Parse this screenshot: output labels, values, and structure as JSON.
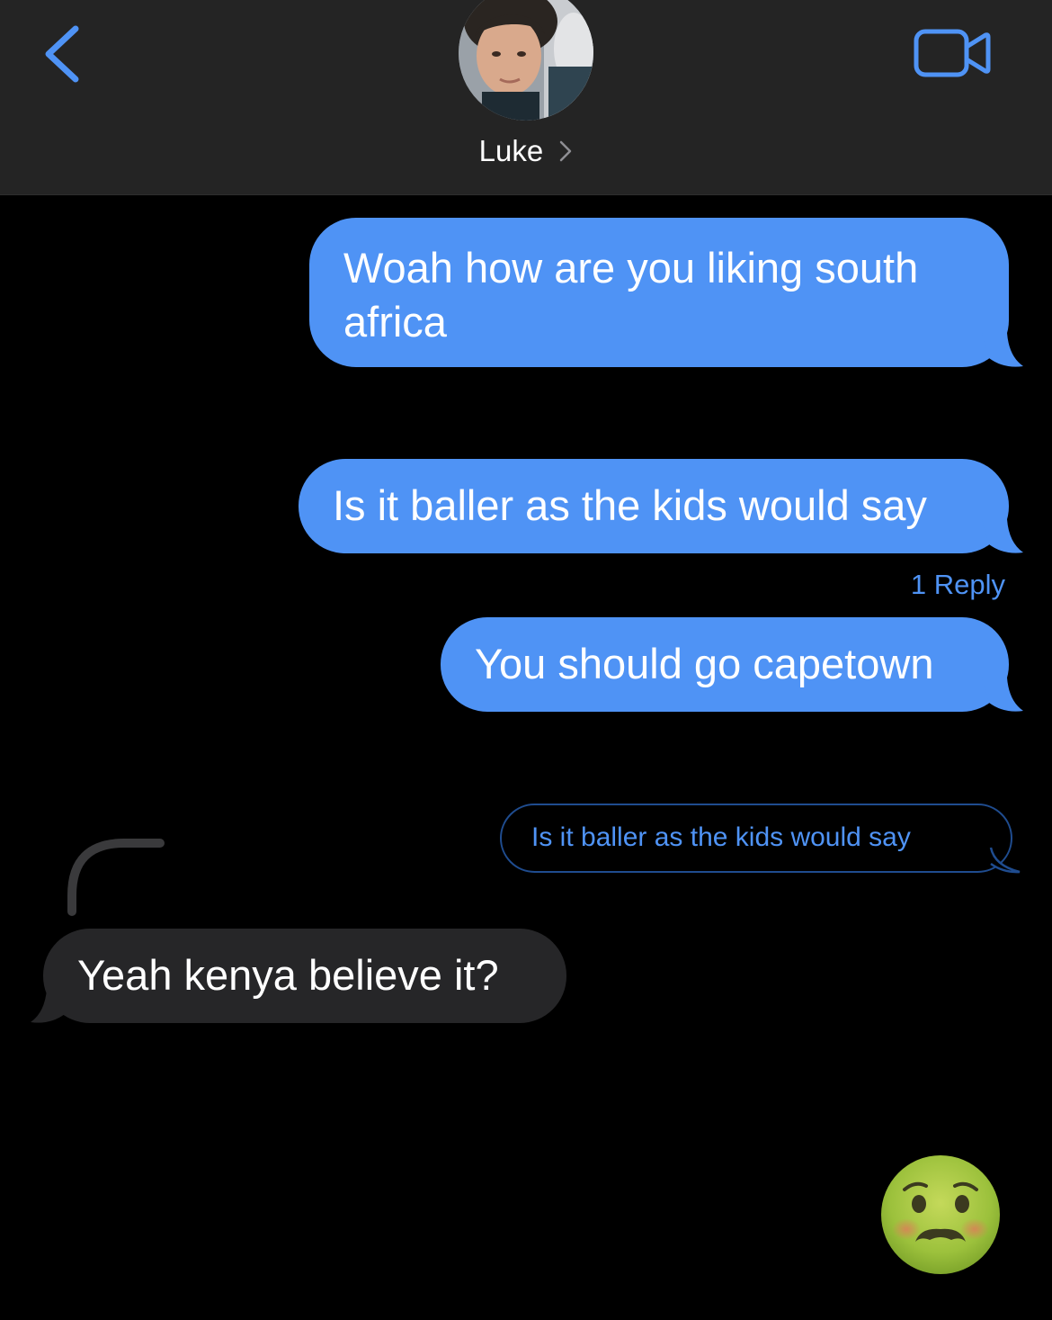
{
  "header": {
    "contact_name": "Luke",
    "icons": {
      "back": "chevron-left-icon",
      "video": "video-camera-icon",
      "name_chevron": "chevron-right-icon"
    }
  },
  "messages": [
    {
      "direction": "outgoing",
      "text": "Woah how are you liking south africa"
    },
    {
      "direction": "outgoing",
      "text": "Is it baller as the kids would say"
    },
    {
      "direction": "outgoing",
      "text": "You should go capetown"
    },
    {
      "direction": "incoming",
      "text": "Yeah kenya believe it?"
    },
    {
      "direction": "outgoing",
      "text": "",
      "emoji": "nauseated-face"
    }
  ],
  "thread": {
    "reply_count_label": "1 Reply",
    "quoted_text": "Is it baller as the kids would say"
  },
  "colors": {
    "accent": "#4f93f5",
    "outgoing_bubble": "#4f93f5",
    "incoming_bubble": "#262628",
    "header_bg": "#242424",
    "background": "#000000"
  }
}
